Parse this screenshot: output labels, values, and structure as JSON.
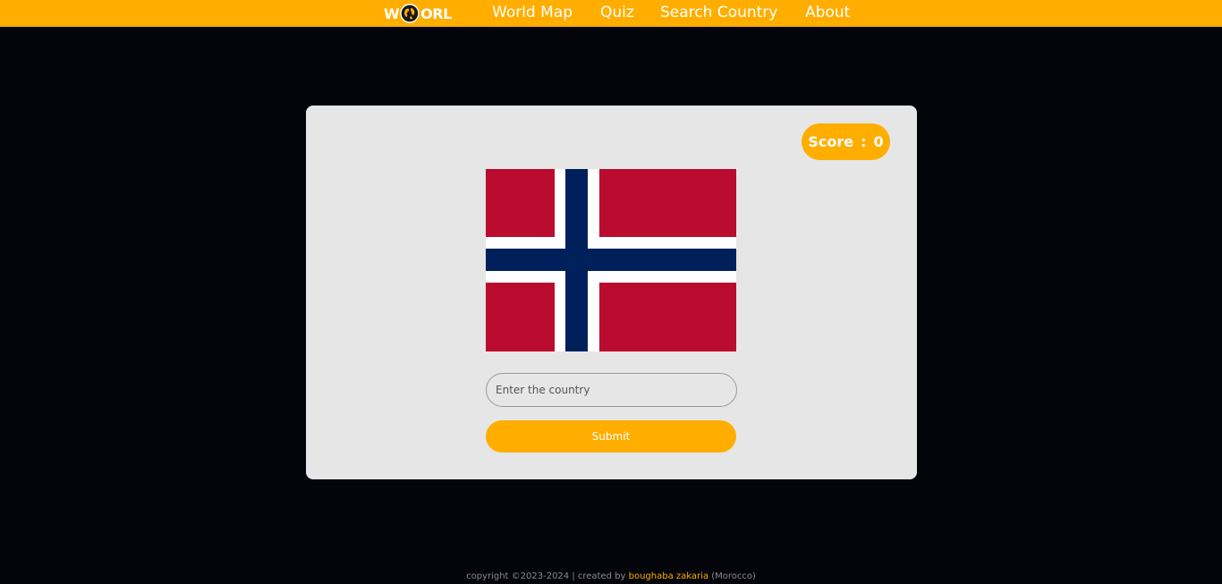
{
  "nav": {
    "logo": {
      "left": "W",
      "right": "ORL"
    },
    "links": [
      "World Map",
      "Quiz",
      "Search Country",
      "About"
    ]
  },
  "quiz": {
    "score_label": "Score",
    "score_separator": ":",
    "score_value": "0",
    "flag_icon": "norway-flag-icon",
    "input_placeholder": "Enter the country",
    "input_value": "",
    "submit_label": "Submit"
  },
  "footer": {
    "prefix": "copyright ©2023-2024 | created by ",
    "author": "boughaba zakaria",
    "suffix": " (Morocco)"
  },
  "colors": {
    "accent": "#ffae00",
    "background": "#03050a",
    "card": "#e6e6e6",
    "flag_red": "#ba0c2f",
    "flag_blue": "#00205b",
    "flag_white": "#ffffff"
  }
}
